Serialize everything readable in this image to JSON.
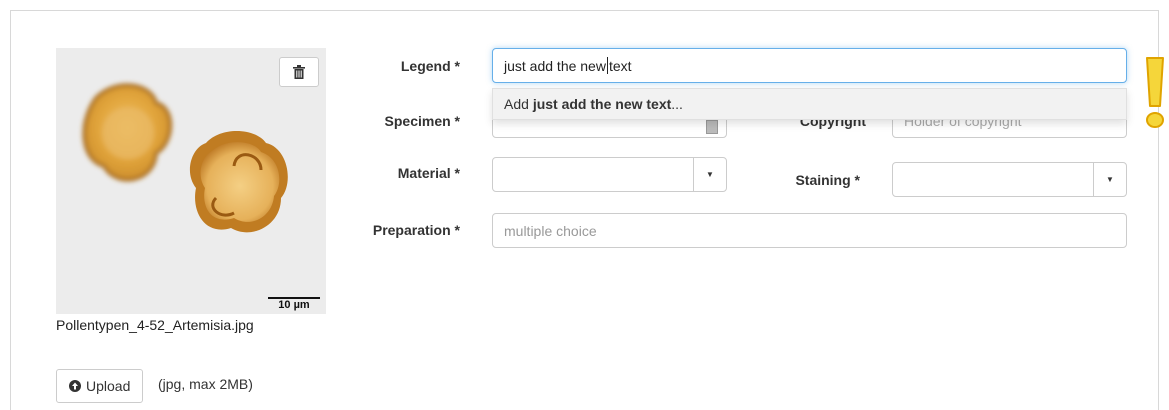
{
  "image": {
    "filename": "Pollentypen_4-52_Artemisia.jpg",
    "scalebar_label": "10 µm"
  },
  "upload": {
    "button_label": "Upload",
    "note": "(jpg, max 2MB)"
  },
  "form": {
    "legend": {
      "label": "Legend *",
      "value_before_cursor": "just add the new",
      "value_after_cursor": "text"
    },
    "suggestion": {
      "prefix": "Add ",
      "bold": "just add the new text",
      "suffix": "..."
    },
    "specimen": {
      "label": "Specimen *"
    },
    "copyright": {
      "label": "Copyright",
      "placeholder": "Holder of copyright"
    },
    "material": {
      "label": "Material *"
    },
    "staining": {
      "label": "Staining *"
    },
    "preparation": {
      "label": "Preparation *",
      "placeholder": "multiple choice"
    }
  },
  "warning": {
    "symbol": "!",
    "color": "#f0c419"
  }
}
